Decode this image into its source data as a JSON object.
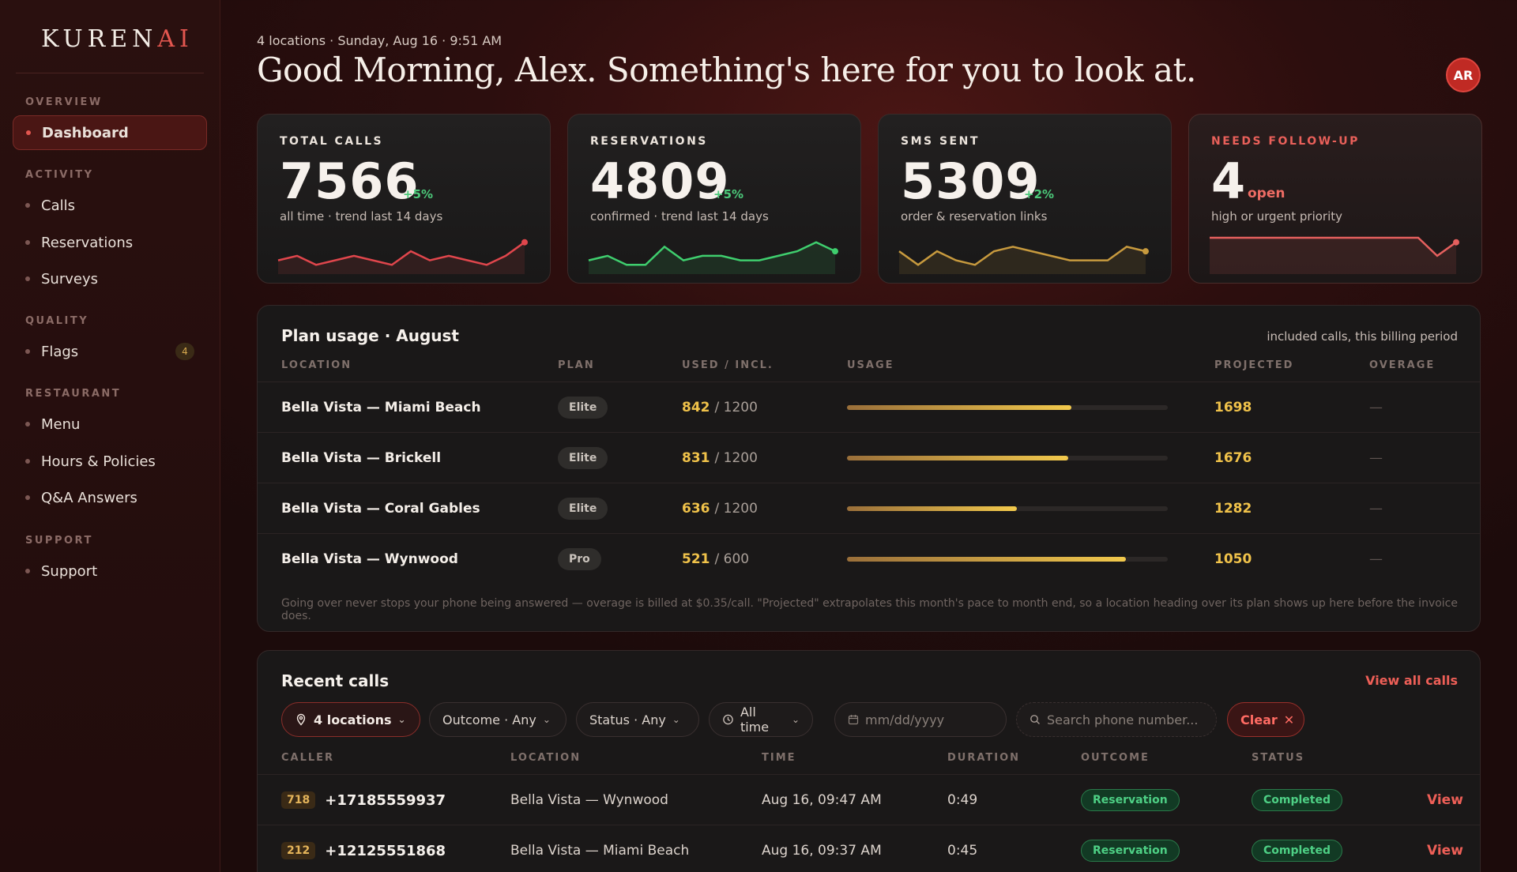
{
  "brand": {
    "name_main": "KUREN",
    "name_accent": "AI"
  },
  "sidebar": {
    "sections": {
      "overview": "OVERVIEW",
      "activity": "ACTIVITY",
      "quality": "QUALITY",
      "restaurant": "RESTAURANT",
      "support": "SUPPORT"
    },
    "items": {
      "dashboard": "Dashboard",
      "calls": "Calls",
      "reservations": "Reservations",
      "surveys": "Surveys",
      "flags": "Flags",
      "flags_badge": "4",
      "menu": "Menu",
      "hours": "Hours & Policies",
      "qa": "Q&A Answers",
      "support": "Support"
    }
  },
  "header": {
    "subhead": "4 locations · Sunday, Aug 16 · 9:51 AM",
    "greeting": "Good Morning, Alex. Something's here for you to look at.",
    "avatar": "AR"
  },
  "stats": [
    {
      "label": "TOTAL CALLS",
      "value": "7566",
      "delta": "+5%",
      "sub": "all time · trend last 14 days",
      "color": "#e0464c",
      "trend": [
        5,
        4,
        6,
        5,
        4,
        5,
        6,
        3,
        5,
        4,
        5,
        6,
        4,
        1
      ]
    },
    {
      "label": "RESERVATIONS",
      "value": "4809",
      "delta": "+5%",
      "sub": "confirmed · trend last 14 days",
      "color": "#3fce6e",
      "trend": [
        5,
        4,
        6,
        6,
        2,
        5,
        4,
        4,
        5,
        5,
        4,
        3,
        1,
        3
      ]
    },
    {
      "label": "SMS SENT",
      "value": "5309",
      "delta": "+2%",
      "sub": "order & reservation links",
      "color": "#c79a3e",
      "trend": [
        3,
        6,
        3,
        5,
        6,
        3,
        2,
        3,
        4,
        5,
        5,
        5,
        2,
        3
      ]
    },
    {
      "label": "NEEDS FOLLOW-UP",
      "value": "4",
      "delta": "open",
      "sub": "high or urgent priority",
      "color": "#e5605e",
      "trend": [
        0,
        0,
        0,
        0,
        0,
        0,
        0,
        0,
        0,
        0,
        0,
        0,
        4,
        1
      ]
    }
  ],
  "plan_usage": {
    "title": "Plan usage · August",
    "note": "included calls, this billing period",
    "headers": [
      "LOCATION",
      "PLAN",
      "USED / INCL.",
      "USAGE",
      "PROJECTED",
      "OVERAGE"
    ],
    "rows": [
      {
        "location": "Bella Vista — Miami Beach",
        "plan": "Elite",
        "used": "842",
        "incl": "/ 1200",
        "usage": 0.7,
        "projected": "1698",
        "overage": "—"
      },
      {
        "location": "Bella Vista — Brickell",
        "plan": "Elite",
        "used": "831",
        "incl": "/ 1200",
        "usage": 0.69,
        "projected": "1676",
        "overage": "—"
      },
      {
        "location": "Bella Vista — Coral Gables",
        "plan": "Elite",
        "used": "636",
        "incl": "/ 1200",
        "usage": 0.53,
        "projected": "1282",
        "overage": "—"
      },
      {
        "location": "Bella Vista — Wynwood",
        "plan": "Pro",
        "used": "521",
        "incl": "/ 600",
        "usage": 0.87,
        "projected": "1050",
        "overage": "—"
      }
    ],
    "footnote": "Going over never stops your phone being answered — overage is billed at $0.35/call. \"Projected\" extrapolates this month's pace to month end, so a location heading over its plan shows up here before the invoice does."
  },
  "recent_calls": {
    "title": "Recent calls",
    "view_all": "View all calls",
    "filters": {
      "locations": "4 locations",
      "outcome": "Outcome · Any",
      "status": "Status · Any",
      "time": "All time",
      "date_placeholder": "mm/dd/yyyy",
      "search_placeholder": "Search phone number...",
      "clear": "Clear"
    },
    "headers": [
      "CALLER",
      "LOCATION",
      "TIME",
      "DURATION",
      "OUTCOME",
      "STATUS"
    ],
    "rows": [
      {
        "area": "718",
        "phone": "+17185559937",
        "location": "Bella Vista — Wynwood",
        "time": "Aug 16, 09:47 AM",
        "duration": "0:49",
        "outcome": "Reservation",
        "status": "Completed",
        "action": "View"
      },
      {
        "area": "212",
        "phone": "+12125551868",
        "location": "Bella Vista — Miami Beach",
        "time": "Aug 16, 09:37 AM",
        "duration": "0:45",
        "outcome": "Reservation",
        "status": "Completed",
        "action": "View"
      }
    ]
  }
}
